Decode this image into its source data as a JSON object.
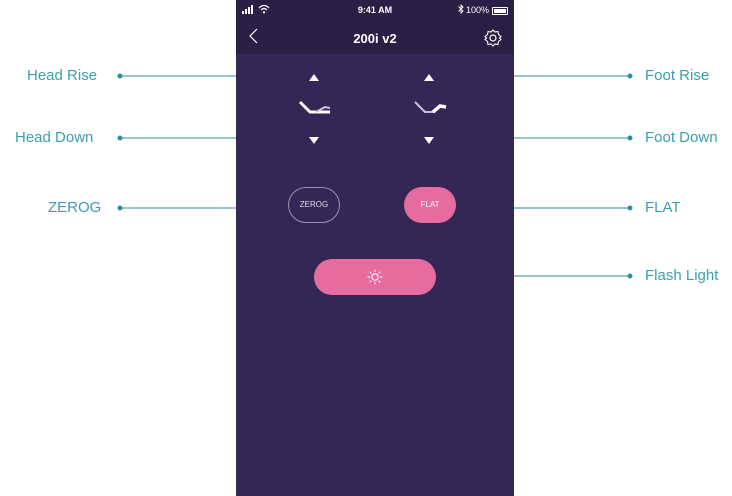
{
  "status_bar": {
    "time": "9:41 AM",
    "battery": "100%"
  },
  "nav": {
    "title": "200i v2",
    "back_icon": "chevron-left-icon",
    "settings_icon": "gear-icon"
  },
  "controls": {
    "zerog_label": "ZEROG",
    "flat_label": "FLAT",
    "flash_icon": "light-bulb-icon"
  },
  "annotations": {
    "head_rise": "Head Rise",
    "head_down": "Head Down",
    "zerog": "ZEROG",
    "foot_rise": "Foot Rise",
    "foot_down": "Foot Down",
    "flat": "FLAT",
    "flash_light": "Flash Light"
  },
  "colors": {
    "phone_background": "#352755",
    "header_background": "#2a1f45",
    "accent_pink": "#e66ca0",
    "annotation_teal": "#3a9fae"
  }
}
